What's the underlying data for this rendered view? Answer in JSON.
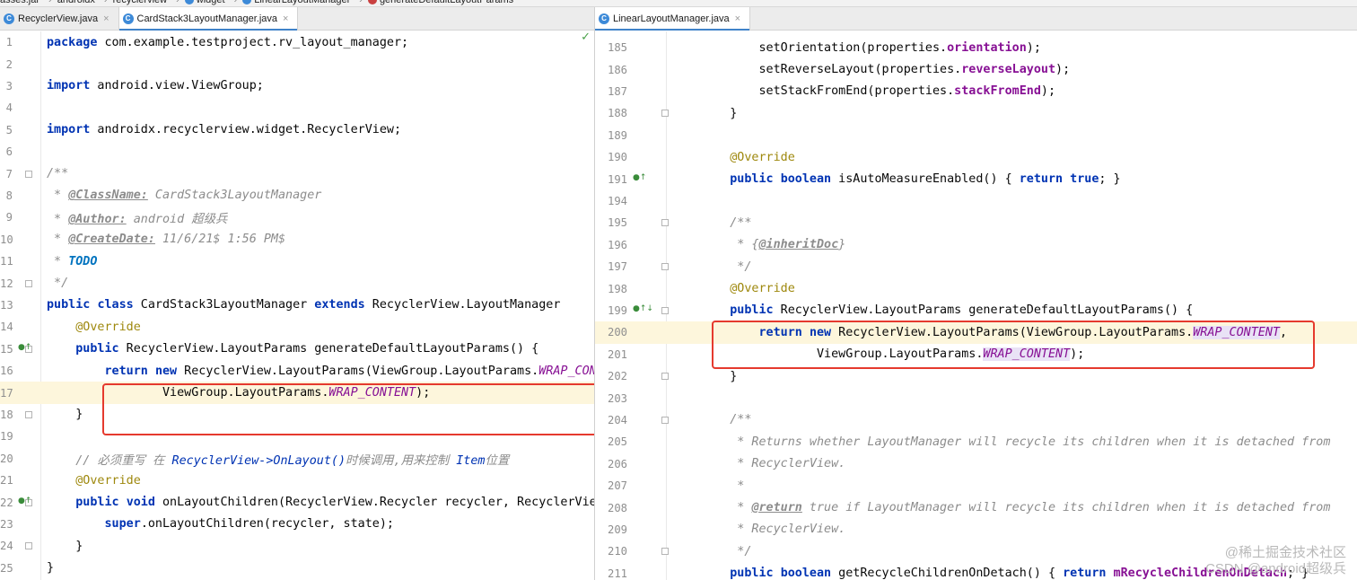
{
  "breadcrumb": {
    "items": [
      "asses.jar",
      "androidx",
      "recyclerview",
      "widget",
      "LinearLayoutManager",
      "generateDefaultLayoutParams"
    ],
    "method_icon_letter": "m"
  },
  "left_pane": {
    "tabs": [
      {
        "label": "RecyclerView.java",
        "active": false
      },
      {
        "label": "CardStack3LayoutManager.java",
        "active": true
      }
    ],
    "tab_icon_letter": "C",
    "close_glyph": "×",
    "lines": [
      {
        "n": "1",
        "code": "package com.example.testproject.rv_layout_manager;"
      },
      {
        "n": "2",
        "code": ""
      },
      {
        "n": "3",
        "code": "import android.view.ViewGroup;"
      },
      {
        "n": "4",
        "code": ""
      },
      {
        "n": "5",
        "code": "import androidx.recyclerview.widget.RecyclerView;"
      },
      {
        "n": "6",
        "code": ""
      },
      {
        "n": "7",
        "code": "/**"
      },
      {
        "n": "8",
        "code": " * @ClassName: CardStack3LayoutManager"
      },
      {
        "n": "9",
        "code": " * @Author: android 超级兵"
      },
      {
        "n": "10",
        "code": " * @CreateDate: 11/6/21$ 1:56 PM$"
      },
      {
        "n": "11",
        "code": " * TODO"
      },
      {
        "n": "12",
        "code": " */"
      },
      {
        "n": "13",
        "code": "public class CardStack3LayoutManager extends RecyclerView.LayoutManager"
      },
      {
        "n": "14",
        "code": "    @Override"
      },
      {
        "n": "15",
        "code": "    public RecyclerView.LayoutParams generateDefaultLayoutParams() {"
      },
      {
        "n": "16",
        "code": "        return new RecyclerView.LayoutParams(ViewGroup.LayoutParams.WRAP_CONTENT,"
      },
      {
        "n": "17",
        "code": "                ViewGroup.LayoutParams.WRAP_CONTENT);"
      },
      {
        "n": "18",
        "code": "    }"
      },
      {
        "n": "19",
        "code": ""
      },
      {
        "n": "20",
        "code": "    // 必须重写 在 RecyclerView->OnLayout()时候调用,用来控制 Item位置"
      },
      {
        "n": "21",
        "code": "    @Override"
      },
      {
        "n": "22",
        "code": "    public void onLayoutChildren(RecyclerView.Recycler recycler, RecyclerView.State state) {"
      },
      {
        "n": "23",
        "code": "        super.onLayoutChildren(recycler, state);"
      },
      {
        "n": "24",
        "code": "    }"
      },
      {
        "n": "25",
        "code": "}"
      }
    ]
  },
  "right_pane": {
    "tabs": [
      {
        "label": "LinearLayoutManager.java",
        "active": true
      }
    ],
    "tab_icon_letter": "C",
    "close_glyph": "×",
    "lines": [
      {
        "n": "185",
        "code": "        setOrientation(properties.orientation);"
      },
      {
        "n": "186",
        "code": "        setReverseLayout(properties.reverseLayout);"
      },
      {
        "n": "187",
        "code": "        setStackFromEnd(properties.stackFromEnd);"
      },
      {
        "n": "188",
        "code": "    }"
      },
      {
        "n": "189",
        "code": ""
      },
      {
        "n": "190",
        "code": "    @Override"
      },
      {
        "n": "191",
        "code": "    public boolean isAutoMeasureEnabled() { return true; }"
      },
      {
        "n": "194",
        "code": ""
      },
      {
        "n": "195",
        "code": "    /**"
      },
      {
        "n": "196",
        "code": "     * {@inheritDoc}"
      },
      {
        "n": "197",
        "code": "     */"
      },
      {
        "n": "198",
        "code": "    @Override"
      },
      {
        "n": "199",
        "code": "    public RecyclerView.LayoutParams generateDefaultLayoutParams() {"
      },
      {
        "n": "200",
        "code": "        return new RecyclerView.LayoutParams(ViewGroup.LayoutParams.WRAP_CONTENT,"
      },
      {
        "n": "201",
        "code": "                ViewGroup.LayoutParams.WRAP_CONTENT);"
      },
      {
        "n": "202",
        "code": "    }"
      },
      {
        "n": "203",
        "code": ""
      },
      {
        "n": "204",
        "code": "    /**"
      },
      {
        "n": "205",
        "code": "     * Returns whether LayoutManager will recycle its children when it is detached from"
      },
      {
        "n": "206",
        "code": "     * RecyclerView."
      },
      {
        "n": "207",
        "code": "     *"
      },
      {
        "n": "208",
        "code": "     * @return true if LayoutManager will recycle its children when it is detached from"
      },
      {
        "n": "209",
        "code": "     * RecyclerView."
      },
      {
        "n": "210",
        "code": "     */"
      },
      {
        "n": "211",
        "code": "    public boolean getRecycleChildrenOnDetach() { return mRecycleChildrenOnDetach; }"
      }
    ]
  },
  "watermark": {
    "top": "@稀土掘金技术社区",
    "bottom": "CSDN @android超级兵"
  },
  "colors": {
    "keyword": "#0033b3",
    "annotation": "#9e880d",
    "static_field": "#871094",
    "comment": "#8c8c8c",
    "todo": "#0073bf",
    "highlight_box": "#e53a2e",
    "current_line": "#fdf6dc",
    "tab_underline": "#4083c9"
  }
}
